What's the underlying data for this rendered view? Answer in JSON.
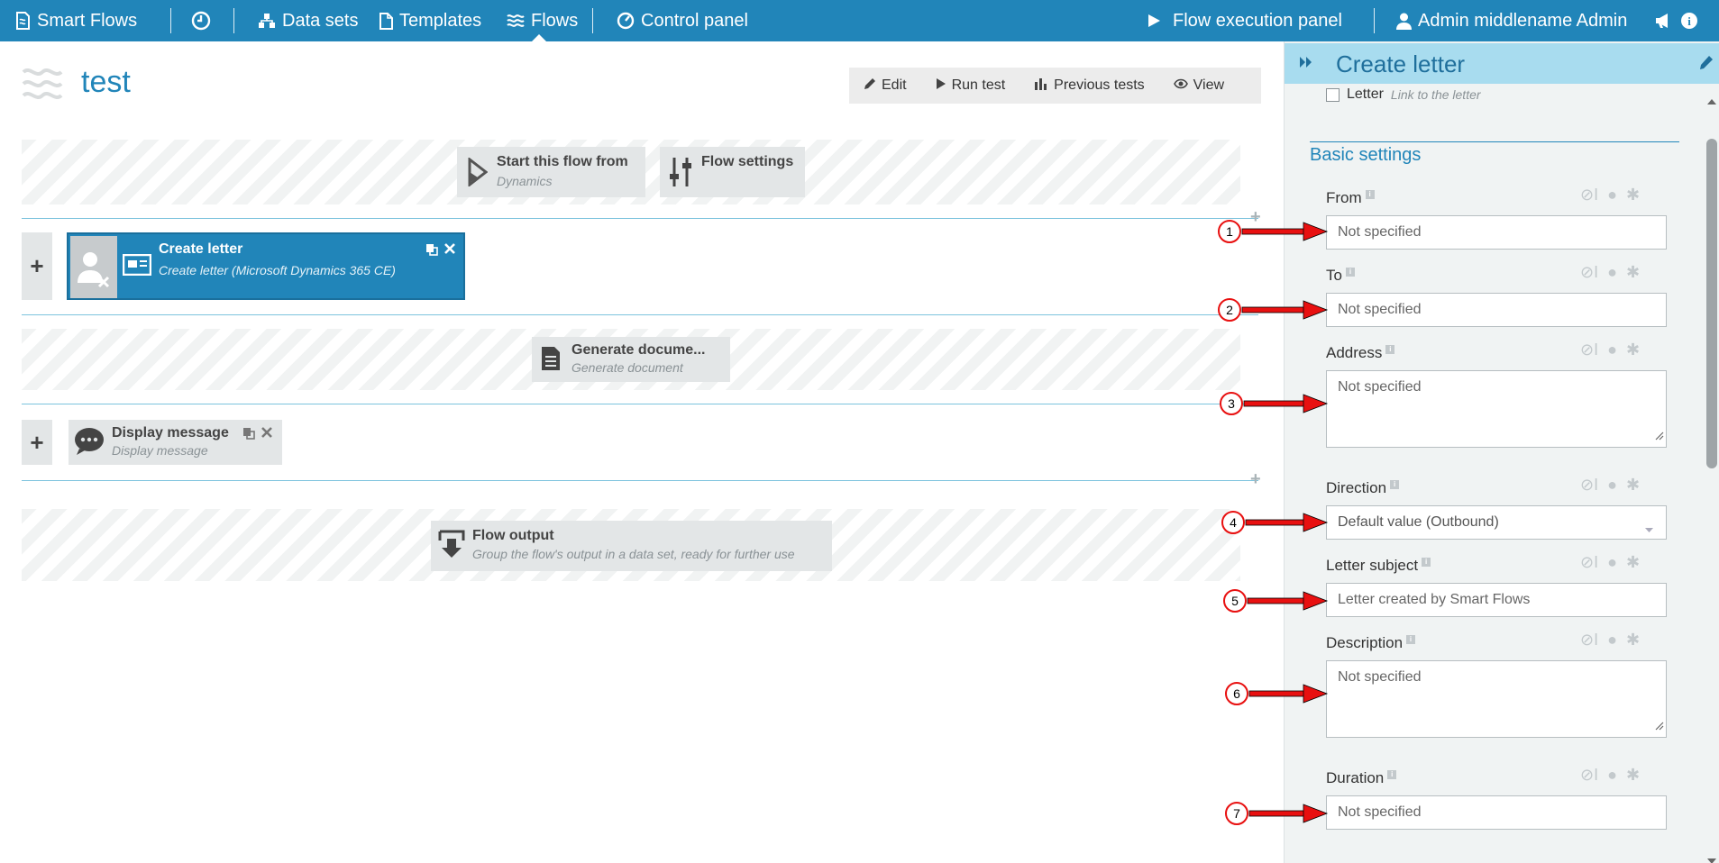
{
  "nav": {
    "app_name": "Smart Flows",
    "data_sets": "Data sets",
    "templates": "Templates",
    "flows": "Flows",
    "control_panel": "Control panel",
    "flow_execution_panel": "Flow execution panel",
    "user_name": "Admin middlename Admin"
  },
  "page": {
    "title": "test"
  },
  "toolbar": {
    "edit": "Edit",
    "run_test": "Run test",
    "previous_tests": "Previous tests",
    "view": "View"
  },
  "canvas": {
    "start": {
      "title": "Start this flow from",
      "subtitle": "Dynamics"
    },
    "settings": {
      "title": "Flow settings"
    },
    "create_letter": {
      "title": "Create letter",
      "subtitle": "Create letter (Microsoft Dynamics 365 CE)"
    },
    "generate": {
      "title": "Generate docume...",
      "subtitle": "Generate document"
    },
    "display": {
      "title": "Display message",
      "subtitle": "Display message"
    },
    "output": {
      "title": "Flow output",
      "subtitle": "Group the flow's output in a data set, ready for further use"
    }
  },
  "panel": {
    "title": "Create letter",
    "letter_checkbox_label": "Letter",
    "letter_checkbox_hint": "Link to the letter",
    "section_title": "Basic settings",
    "fields": [
      {
        "label": "From",
        "value": "Not specified",
        "marker": "1"
      },
      {
        "label": "To",
        "value": "Not specified",
        "marker": "2"
      },
      {
        "label": "Address",
        "value": "Not specified",
        "marker": "3"
      },
      {
        "label": "Direction",
        "value": "Default value (Outbound)",
        "marker": "4"
      },
      {
        "label": "Letter subject",
        "value": "Letter created by Smart Flows",
        "marker": "5"
      },
      {
        "label": "Description",
        "value": "Not specified",
        "marker": "6"
      },
      {
        "label": "Duration",
        "value": "Not specified",
        "marker": "7"
      }
    ]
  },
  "colors": {
    "primary": "#2185b9",
    "panel_header": "#a8dcef",
    "arrow": "#e81010"
  }
}
